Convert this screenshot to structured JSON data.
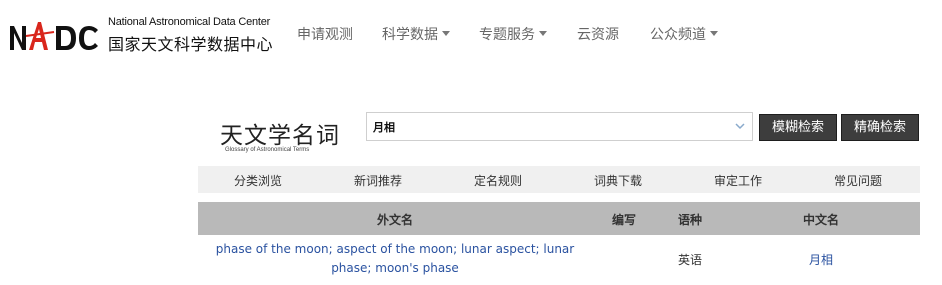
{
  "logo": {
    "mark_text": "NADC",
    "name_en": "National Astronomical Data Center",
    "name_cn": "国家天文科学数据中心"
  },
  "topnav": {
    "items": [
      {
        "label": "申请观测",
        "dropdown": false
      },
      {
        "label": "科学数据",
        "dropdown": true
      },
      {
        "label": "专题服务",
        "dropdown": true
      },
      {
        "label": "云资源",
        "dropdown": false
      },
      {
        "label": "公众频道",
        "dropdown": true
      }
    ]
  },
  "glossary": {
    "title": "天文学名词",
    "subtitle": "Glossary of Astronomical Terms"
  },
  "search": {
    "value": "月相",
    "fuzzy_button": "模糊检索",
    "exact_button": "精确检索"
  },
  "subnav": {
    "items": [
      "分类浏览",
      "新词推荐",
      "定名规则",
      "词典下载",
      "审定工作",
      "常见问题"
    ]
  },
  "table": {
    "headers": {
      "foreign": "外文名",
      "abbr": "编写",
      "lang": "语种",
      "chinese": "中文名"
    },
    "rows": [
      {
        "foreign_line1": "phase of the moon; aspect of the moon; lunar aspect; lunar",
        "foreign_line2": "phase; moon's phase",
        "abbr": "",
        "lang": "英语",
        "chinese": "月相"
      }
    ]
  },
  "colors": {
    "link_blue": "#2a52a0",
    "button_dark": "#3d3d3d",
    "logo_red": "#d9261c",
    "table_header_gray": "#b9b9b9",
    "subnav_gray": "#f0f0f0"
  }
}
